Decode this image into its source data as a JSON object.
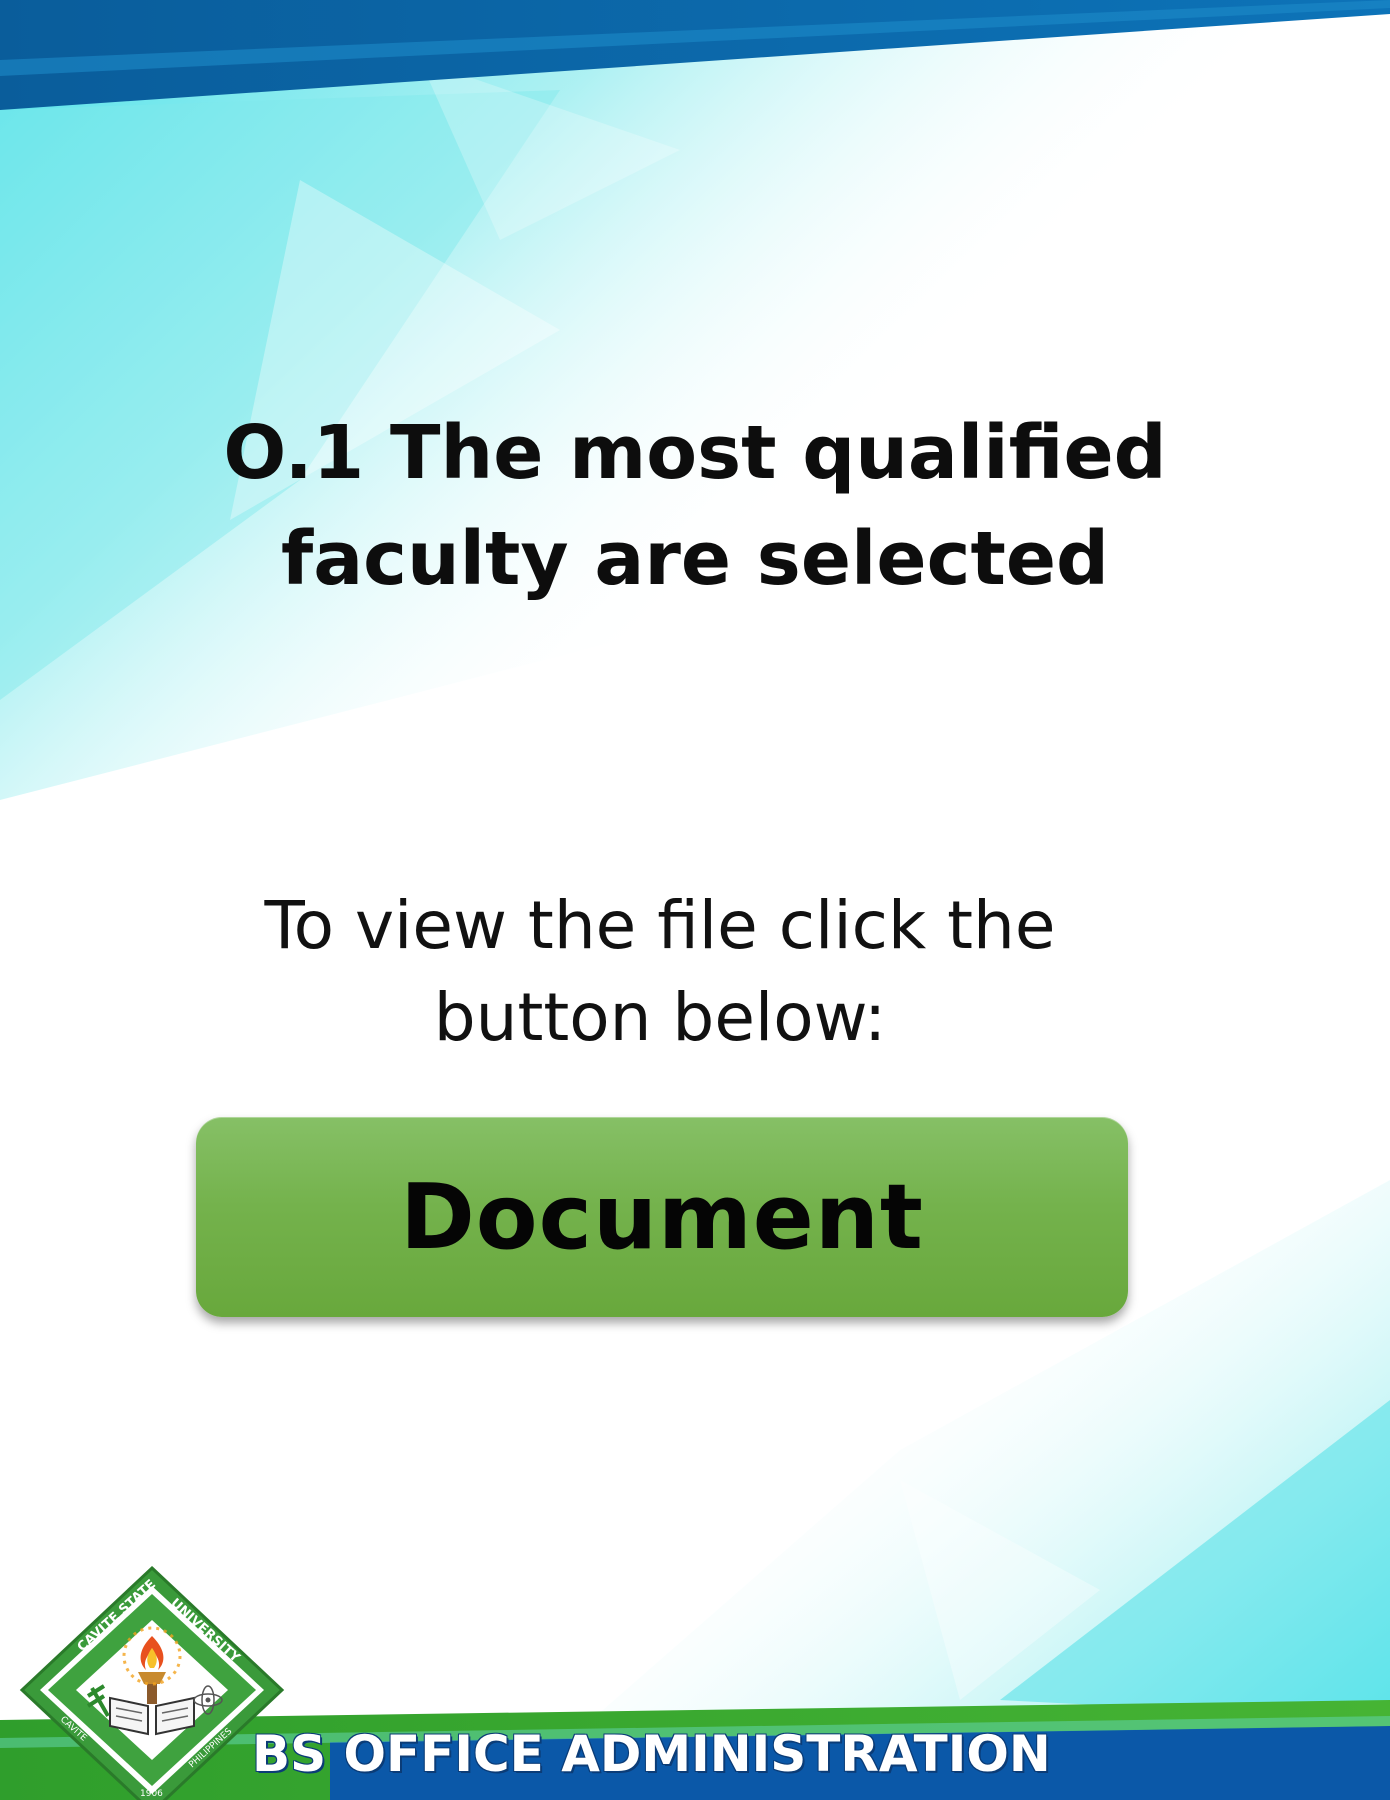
{
  "title": {
    "line1": "O.1 The most qualified",
    "line2": "faculty are selected"
  },
  "instruction": {
    "line1": "To view the file click the",
    "line2": "button below:"
  },
  "button": {
    "label": "Document"
  },
  "footer": {
    "program": "BS OFFICE ADMINISTRATION"
  },
  "seal": {
    "top_text": "CAVITE STATE UNIVERSITY",
    "bottom_left": "CAVITE",
    "bottom_right": "PHILIPPINES",
    "year": "1906"
  },
  "colors": {
    "top_band": "#0a66a8",
    "teal": "#4fe0e8",
    "button": "#74b24c",
    "footer_green": "#3aa92e",
    "footer_blue": "#0b58a8"
  }
}
